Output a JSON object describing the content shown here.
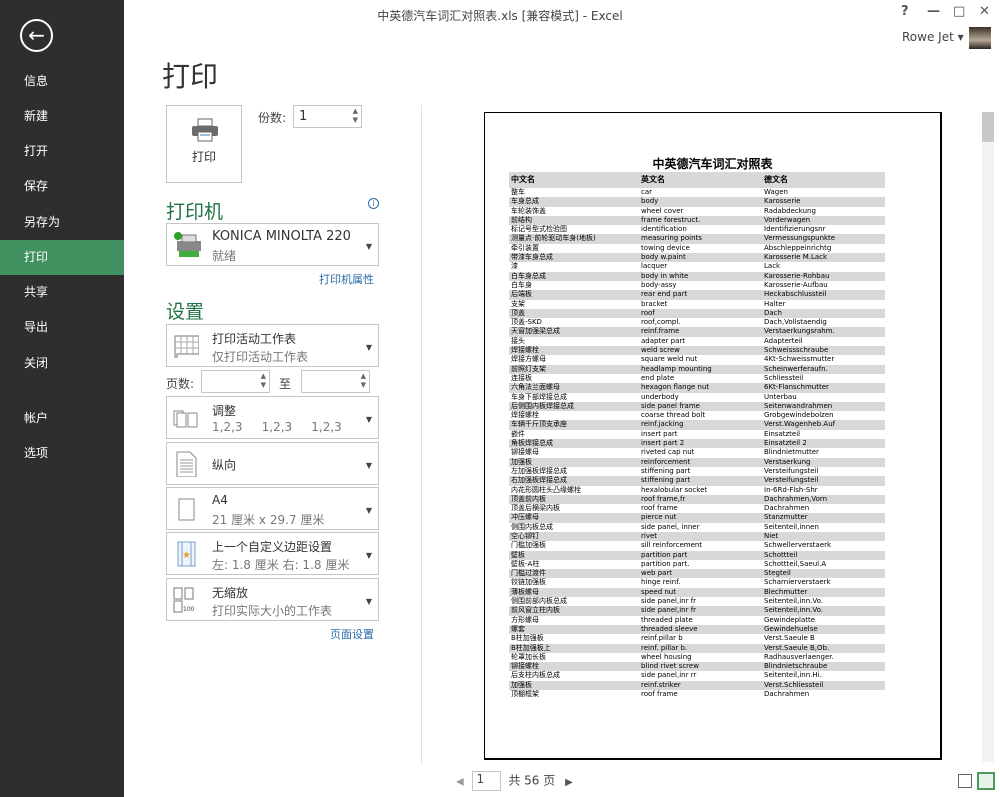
{
  "window": {
    "title": "中英德汽车词汇对照表.xls  [兼容模式] - Excel",
    "help": "?",
    "minimize": "—",
    "maximize": "□",
    "close": "✕",
    "user": "Rowe Jet ▾"
  },
  "sidebar": {
    "back": "←",
    "items": [
      "信息",
      "新建",
      "打开",
      "保存",
      "另存为",
      "打印",
      "共享",
      "导出",
      "关闭",
      "帐户",
      "选项"
    ],
    "selected": 5
  },
  "print": {
    "heading": "打印",
    "button": "打印",
    "copies_label": "份数:",
    "copies": "1"
  },
  "printer": {
    "heading": "打印机",
    "name": "KONICA MINOLTA 220",
    "status": "就绪",
    "properties": "打印机属性",
    "info": "i"
  },
  "settings": {
    "heading": "设置",
    "what": {
      "title": "打印活动工作表",
      "sub": "仅打印活动工作表"
    },
    "pages_label": "页数:",
    "to_label": "至",
    "pages_from": "",
    "pages_to": "",
    "collate": {
      "title": "调整",
      "sub": [
        "1,2,3",
        "1,2,3",
        "1,2,3"
      ]
    },
    "orientation": {
      "title": "纵向"
    },
    "paper": {
      "title": "A4",
      "sub": "21 厘米 x 29.7 厘米"
    },
    "margins": {
      "title": "上一个自定义边距设置",
      "sub": "左:  1.8 厘米     右:  1.8 厘米"
    },
    "scaling": {
      "title": "无缩放",
      "sub": "打印实际大小的工作表"
    },
    "page_setup": "页面设置"
  },
  "preview": {
    "title": "中英德汽车词汇对照表",
    "headers": [
      "中文名",
      "英文名",
      "德文名"
    ],
    "rows": [
      [
        "整车",
        "car",
        "Wagen"
      ],
      [
        "车身总成",
        "body",
        "Karosserie"
      ],
      [
        "车轮装饰盖",
        "wheel cover",
        "Radabdeckung"
      ],
      [
        "前结构",
        "frame forestruct.",
        "Vorderwagen"
      ],
      [
        "标记号型式检验图",
        "identification",
        "Identifizierungsnr"
      ],
      [
        "测量点·前轮驱动车身(地板)",
        "measuring points",
        "Vermessungspunkte"
      ],
      [
        "牵引装置",
        "towing device",
        "Abschleppeinrichtg"
      ],
      [
        "带漆车身总成",
        "body w.paint",
        "Karosserie M.Lack"
      ],
      [
        "漆",
        "lacquer",
        "Lack"
      ],
      [
        "白车身总成",
        "body in white",
        "Karosserie-Rohbau"
      ],
      [
        "白车身",
        "body-assy",
        "Karosserie-Aufbau"
      ],
      [
        "后端板",
        "rear end part",
        "Heckabschlussteil"
      ],
      [
        "支架",
        "bracket",
        "Halter"
      ],
      [
        "顶盖",
        "roof",
        "Dach"
      ],
      [
        "顶盖-SKD",
        "roof,compl.",
        "Dach,Vollstaendig"
      ],
      [
        "天窗加强梁总成",
        "reinf.frame",
        "Verstaerkungsrahm."
      ],
      [
        "接头",
        "adapter part",
        "Adapterteil"
      ],
      [
        "焊接螺栓",
        "weld screw",
        "Schweissschraube"
      ],
      [
        "焊接方螺母",
        "square weld nut",
        "4Kt-Schweissmutter"
      ],
      [
        "前照灯支架",
        "headlamp mounting",
        "Scheinwerferaufn."
      ],
      [
        "连接板",
        "end plate",
        "Schliessteil"
      ],
      [
        "六角法兰面螺母",
        "hexagon flange nut",
        "6Kt-Flanschmutter"
      ],
      [
        "车身下部焊接总成",
        "underbody",
        "Unterbau"
      ],
      [
        "后侧围内板焊接总成",
        "side panel frame",
        "Seitenwandrahmen"
      ],
      [
        "焊接螺栓",
        "coarse thread bolt",
        "Grobgewindebolzen"
      ],
      [
        "车辆千斤顶支承座",
        "reinf.jacking",
        "Verst.Wagenheb.Auf"
      ],
      [
        "嵌件",
        "insert part",
        "Einsatzteil"
      ],
      [
        "角板焊接总成",
        "insert part 2",
        "Einsatzteil 2"
      ],
      [
        "铆接螺母",
        "riveted cap nut",
        "Blindnietmutter"
      ],
      [
        "加强板",
        "reinforcement",
        "Verstaerkung"
      ],
      [
        "左加强板焊接总成",
        "stiffening part",
        "Versteifungsteil"
      ],
      [
        "右加强板焊接总成",
        "stiffening part",
        "Versteifungsteil"
      ],
      [
        "内花形圆柱头凸缘螺栓",
        "hexalobular socket",
        "In-6Rd-Flsh-Shr"
      ],
      [
        "顶盖前内板",
        "roof frame,fr",
        "Dachrahmen,Vorn"
      ],
      [
        "顶盖后横梁内板",
        "roof frame",
        "Dachrahmen"
      ],
      [
        "冲压螺母",
        "pierce nut",
        "Stanzmutter"
      ],
      [
        "侧围内板总成",
        "side panel, inner",
        "Seitenteil,innen"
      ],
      [
        "空心铆钉",
        "rivet",
        "Niet"
      ],
      [
        "门槛加强板",
        "sill reinforcement",
        "Schwellerverstaerk"
      ],
      [
        "壁板",
        "partition part",
        "Schottteil"
      ],
      [
        "壁板-A柱",
        "partition part.",
        "Schottteil,Saeul.A"
      ],
      [
        "门槛过渡件",
        "web part",
        "Stegteil"
      ],
      [
        "铰链加强板",
        "hinge reinf.",
        "Scharnierverstaerk"
      ],
      [
        "薄板螺母",
        "speed nut",
        "Blechmutter"
      ],
      [
        "侧围前部内板总成",
        "side panel,inr fr",
        "Seitenteil,inn.Vo."
      ],
      [
        "前风窗立柱内板",
        "side panel,inr fr",
        "Seitenteil,inn.Vo."
      ],
      [
        "方形螺母",
        "threaded plate",
        "Gewindeplatte"
      ],
      [
        "螺套",
        "threaded sleeve",
        "Gewindehuelse"
      ],
      [
        "B柱加强板",
        "reinf.pillar b",
        "Verst.Saeule B"
      ],
      [
        "B柱加强板上",
        "reinf. pillar b.",
        "Verst.Saeule B,Ob."
      ],
      [
        "轮罩加长板",
        "wheel housing",
        "Radhausverlaenger."
      ],
      [
        "铆接螺栓",
        "blind rivet screw",
        "Blindnietschraube"
      ],
      [
        "后支柱内板总成",
        "side panel,inr rr",
        "Seitenteil,inn.Hi."
      ],
      [
        "加强板",
        "reinf.striker",
        "Verst.Schliessteil"
      ],
      [
        "顶棚框架",
        "roof frame",
        "Dachrahmen"
      ]
    ]
  },
  "pager": {
    "current": "1",
    "total": "共 56 页"
  },
  "colors": {
    "sidebar": "#2e2e2e",
    "selected": "#40915f",
    "accent": "#217346"
  }
}
